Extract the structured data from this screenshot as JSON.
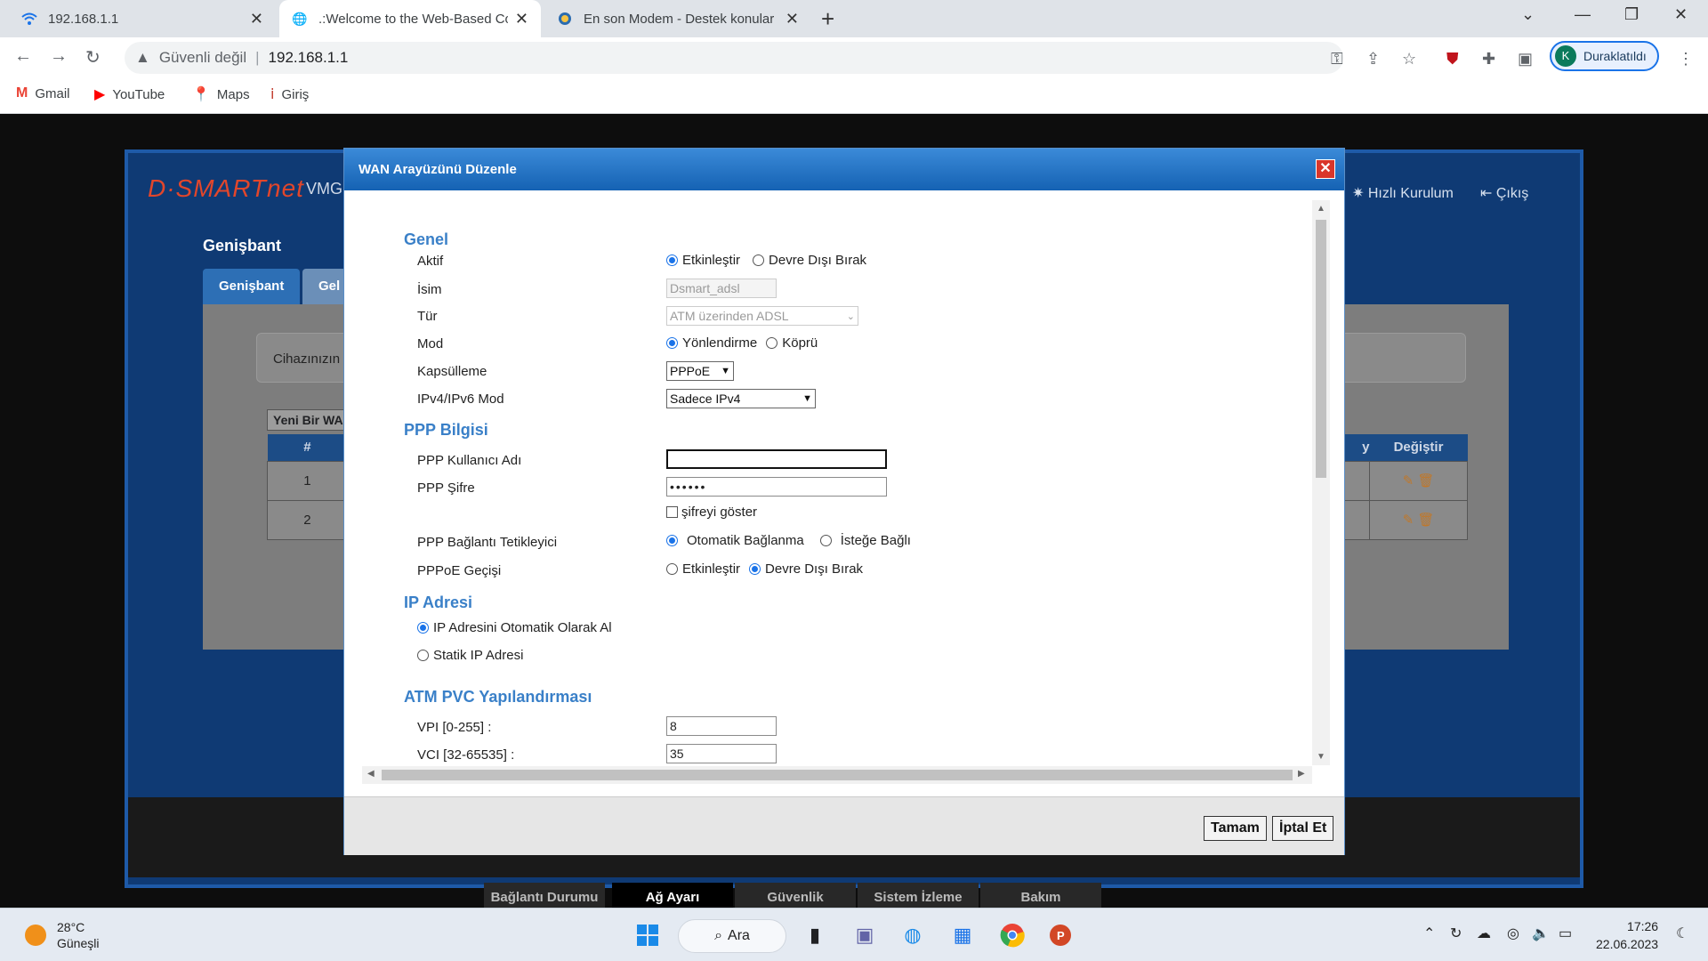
{
  "browser": {
    "tabs": [
      {
        "title": "192.168.1.1",
        "icon": "wifi-icon"
      },
      {
        "title": ".:Welcome to the Web-Based Co",
        "icon": "globe-icon"
      },
      {
        "title": "En son Modem - Destek konular",
        "icon": "forum-icon"
      }
    ],
    "security_label": "Güvenli değil",
    "url": "192.168.1.1",
    "profile_initial": "K",
    "profile_status": "Duraklatıldı",
    "bookmarks": [
      {
        "label": "Gmail",
        "icon": "gmail-icon"
      },
      {
        "label": "YouTube",
        "icon": "youtube-icon"
      },
      {
        "label": "Maps",
        "icon": "maps-icon"
      },
      {
        "label": "Giriş",
        "icon": "login-icon"
      }
    ]
  },
  "router": {
    "logo": "D·SMARTnet",
    "model": "VMG",
    "quick_setup": "Hızlı Kurulum",
    "logout": "Çıkış",
    "page_title": "Genişbant",
    "tabs": [
      "Genişbant",
      "Gel"
    ],
    "info_text": "Cihazınızın",
    "new_wan": "Yeni Bir WA",
    "table_headers": [
      "#",
      "y",
      "Değiştir"
    ],
    "rows": [
      "1",
      "2"
    ],
    "bottom_nav": [
      "Bağlantı Durumu",
      "Ağ Ayarı",
      "Güvenlik",
      "Sistem İzleme",
      "Bakım"
    ]
  },
  "modal": {
    "title": "WAN Arayüzünü Düzenle",
    "sections": {
      "general": "Genel",
      "ppp": "PPP Bilgisi",
      "ip": "IP Adresi",
      "atm": "ATM PVC Yapılandırması"
    },
    "fields": {
      "active_label": "Aktif",
      "active_on": "Etkinleştir",
      "active_off": "Devre Dışı Bırak",
      "name_label": "İsim",
      "name_value": "Dsmart_adsl",
      "type_label": "Tür",
      "type_value": "ATM üzerinden ADSL",
      "mode_label": "Mod",
      "mode_route": "Yönlendirme",
      "mode_bridge": "Köprü",
      "encap_label": "Kapsülleme",
      "encap_value": "PPPoE",
      "ipmode_label": "IPv4/IPv6 Mod",
      "ipmode_value": "Sadece IPv4",
      "ppp_user_label": "PPP Kullanıcı Adı",
      "ppp_user_value": "",
      "ppp_pass_label": "PPP Şifre",
      "ppp_pass_value": "••••••",
      "show_pass": "şifreyi göster",
      "trigger_label": "PPP Bağlantı Tetikleyici",
      "trigger_auto": "Otomatik Bağlanma",
      "trigger_demand": "İsteğe Bağlı",
      "passthrough_label": "PPPoE Geçişi",
      "passthrough_on": "Etkinleştir",
      "passthrough_off": "Devre Dışı Bırak",
      "ip_auto": "IP Adresini Otomatik Olarak Al",
      "ip_static": "Statik IP Adresi",
      "vpi_label": "VPI [0-255] :",
      "vpi_value": "8",
      "vci_label": "VCI [32-65535] :",
      "vci_value": "35"
    },
    "ok_label": "Tamam",
    "cancel_label": "İptal Et"
  },
  "taskbar": {
    "temperature": "28°C",
    "weather": "Güneşli",
    "search_label": "Ara",
    "time": "17:26",
    "date": "22.06.2023"
  }
}
